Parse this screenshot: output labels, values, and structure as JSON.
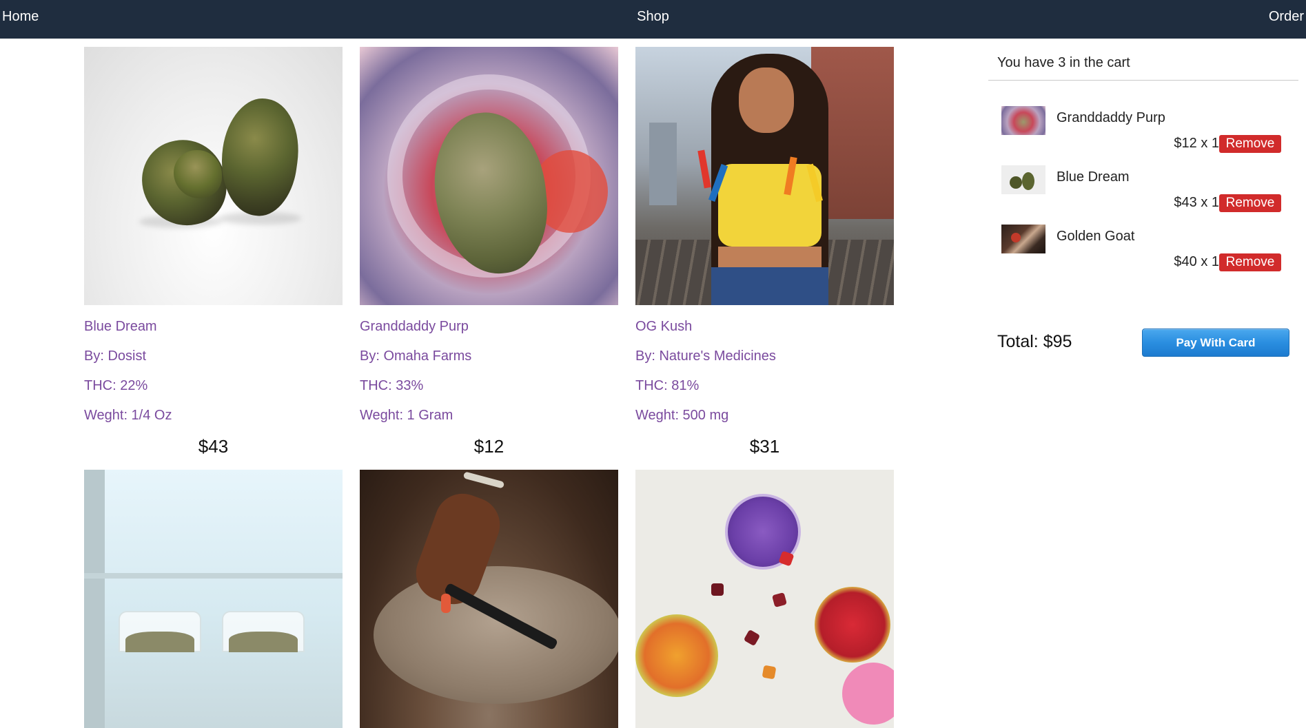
{
  "nav": {
    "home": "Home",
    "shop": "Shop",
    "order": "Order"
  },
  "products": [
    {
      "name": "Blue Dream",
      "by": "By: Dosist",
      "thc": "THC: 22%",
      "weight": "Weght: 1/4 Oz",
      "price": "$43",
      "photo": "cannabis-bud-photo"
    },
    {
      "name": "Granddaddy Purp",
      "by": "By: Omaha Farms",
      "thc": "THC: 33%",
      "weight": "Weght: 1 Gram",
      "price": "$12",
      "photo": "cannabis-jar-photo"
    },
    {
      "name": "OG Kush",
      "by": "By: Nature's Medicines",
      "thc": "THC: 81%",
      "weight": "Weght: 500 mg",
      "price": "$31",
      "photo": "woman-with-vape-pens-photo"
    },
    {
      "photo": "glass-jars-photo"
    },
    {
      "photo": "hand-with-vape-pen-photo"
    },
    {
      "photo": "gummies-tins-photo"
    }
  ],
  "cart": {
    "header": "You have 3 in the cart",
    "items": [
      {
        "name": "Granddaddy Purp",
        "qty": "$12 x 1",
        "remove": "Remove"
      },
      {
        "name": "Blue Dream",
        "qty": "$43 x 1",
        "remove": "Remove"
      },
      {
        "name": "Golden Goat",
        "qty": "$40 x 1",
        "remove": "Remove"
      }
    ],
    "total": "Total: $95",
    "pay": "Pay With Card"
  },
  "colors": {
    "navbar": "#1f2d3f",
    "product_text": "#7a4a9e",
    "remove_button": "#d12b2b",
    "pay_button": "#2a8ee0"
  }
}
